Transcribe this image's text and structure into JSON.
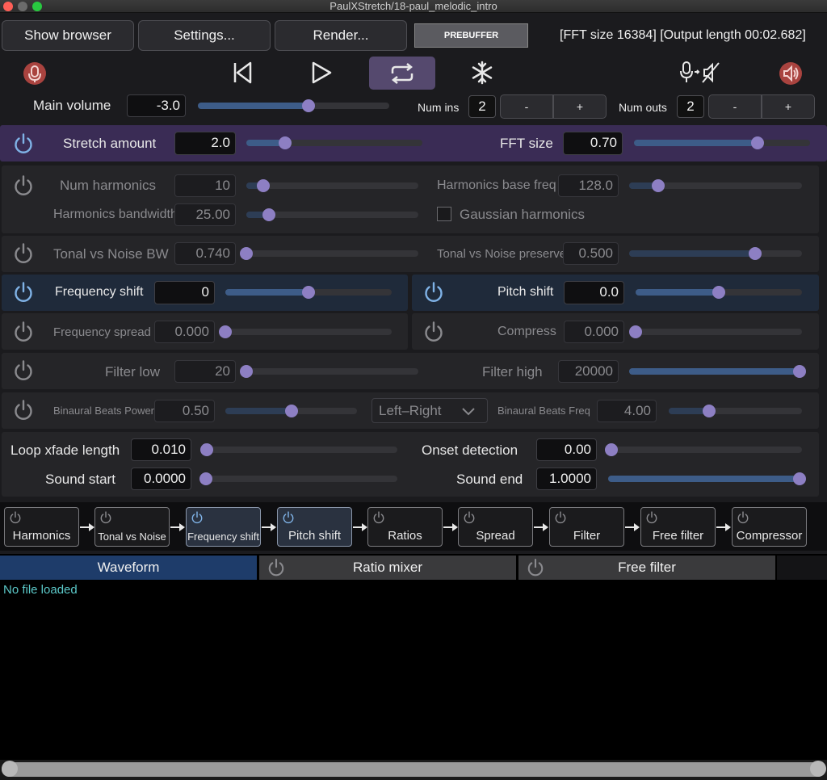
{
  "window": {
    "title": "PaulXStretch/18-paul_melodic_intro"
  },
  "toolbar": {
    "show_browser": "Show browser",
    "settings": "Settings...",
    "render": "Render...",
    "prebuffer": "PREBUFFER",
    "info": "[FFT size 16384] [Output length 00:02.682]"
  },
  "transport": {
    "icons": [
      "mic-icon",
      "skip-back-icon",
      "play-icon",
      "loop-icon",
      "freeze-icon",
      "mic-passthrough-off-icon",
      "speaker-icon"
    ],
    "loop_active": true
  },
  "io": {
    "main_volume_label": "Main volume",
    "main_volume_value": "-3.0",
    "main_volume_level": 0.58,
    "num_ins_label": "Num ins",
    "num_ins_value": "2",
    "num_outs_label": "Num outs",
    "num_outs_value": "2",
    "minus": "-",
    "plus": "+"
  },
  "params": {
    "stretch_label": "Stretch amount",
    "stretch_value": "2.0",
    "stretch_level": 0.22,
    "fft_label": "FFT size",
    "fft_value": "0.70",
    "fft_level": 0.7,
    "num_harm_label": "Num harmonics",
    "num_harm_value": "10",
    "num_harm_level": 0.1,
    "harm_base_label": "Harmonics base freq",
    "harm_base_value": "128.0",
    "harm_base_level": 0.17,
    "harm_bw_label": "Harmonics bandwidth",
    "harm_bw_value": "25.00",
    "harm_bw_level": 0.13,
    "gauss_label": "Gaussian harmonics",
    "tonal_bw_label": "Tonal vs Noise BW",
    "tonal_bw_value": "0.740",
    "tonal_bw_level": 0.0,
    "tonal_pres_label": "Tonal vs Noise preserve",
    "tonal_pres_value": "0.500",
    "tonal_pres_level": 0.73,
    "freq_shift_label": "Frequency shift",
    "freq_shift_value": "0",
    "freq_shift_level": 0.5,
    "pitch_shift_label": "Pitch shift",
    "pitch_shift_value": "0.0",
    "pitch_shift_level": 0.5,
    "freq_spread_label": "Frequency spread",
    "freq_spread_value": "0.000",
    "freq_spread_level": 0.0,
    "compress_label": "Compress",
    "compress_value": "0.000",
    "compress_level": 0.0,
    "filter_low_label": "Filter low",
    "filter_low_value": "20",
    "filter_low_level": 0.0,
    "filter_high_label": "Filter high",
    "filter_high_value": "20000",
    "filter_high_level": 1.0,
    "binaural_power_label": "Binaural Beats Power",
    "binaural_power_value": "0.50",
    "binaural_power_level": 0.5,
    "binaural_mode": "Left–Right",
    "binaural_freq_label": "Binaural Beats Freq",
    "binaural_freq_value": "4.00",
    "binaural_freq_level": 0.3,
    "loop_xfade_label": "Loop xfade length",
    "loop_xfade_value": "0.010",
    "loop_xfade_level": 0.0,
    "onset_label": "Onset detection",
    "onset_value": "0.00",
    "onset_level": 0.0,
    "sound_start_label": "Sound start",
    "sound_start_value": "0.0000",
    "sound_start_level": 0.0,
    "sound_end_label": "Sound end",
    "sound_end_value": "1.0000",
    "sound_end_level": 1.0
  },
  "chain": {
    "modules": [
      "Harmonics",
      "Tonal vs Noise",
      "Frequency shift",
      "Pitch shift",
      "Ratios",
      "Spread",
      "Filter",
      "Free filter",
      "Compressor"
    ]
  },
  "tabs": {
    "waveform": "Waveform",
    "ratio_mixer": "Ratio mixer",
    "free_filter": "Free filter"
  },
  "waveform": {
    "status": "No file loaded"
  },
  "colors": {
    "accent": "#3d5c88",
    "thumb": "#8d7fc3",
    "purple_row": "#3a2c55",
    "status_text": "#5bc8c8"
  }
}
